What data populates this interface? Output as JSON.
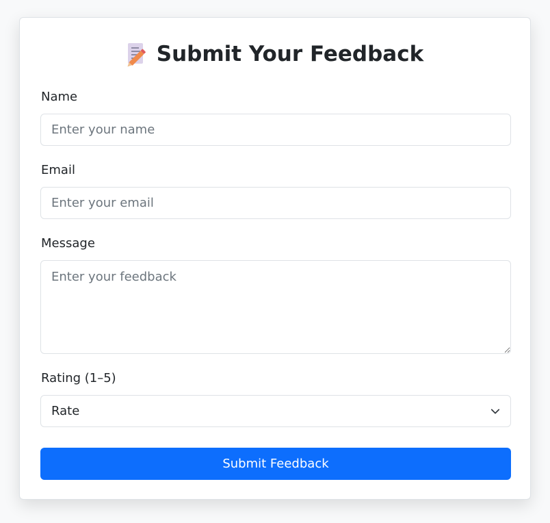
{
  "form": {
    "title": "Submit Your Feedback",
    "title_icon": "memo-icon",
    "name": {
      "label": "Name",
      "placeholder": "Enter your name",
      "value": ""
    },
    "email": {
      "label": "Email",
      "placeholder": "Enter your email",
      "value": ""
    },
    "message": {
      "label": "Message",
      "placeholder": "Enter your feedback",
      "value": ""
    },
    "rating": {
      "label": "Rating (1–5)",
      "selected": "Rate",
      "icon": "chevron-down-icon"
    },
    "submit_label": "Submit Feedback"
  },
  "colors": {
    "accent": "#0d6efd",
    "border": "#dee2e6",
    "text": "#212529",
    "placeholder": "#6c757d",
    "page_background": "#f8f9fa"
  }
}
